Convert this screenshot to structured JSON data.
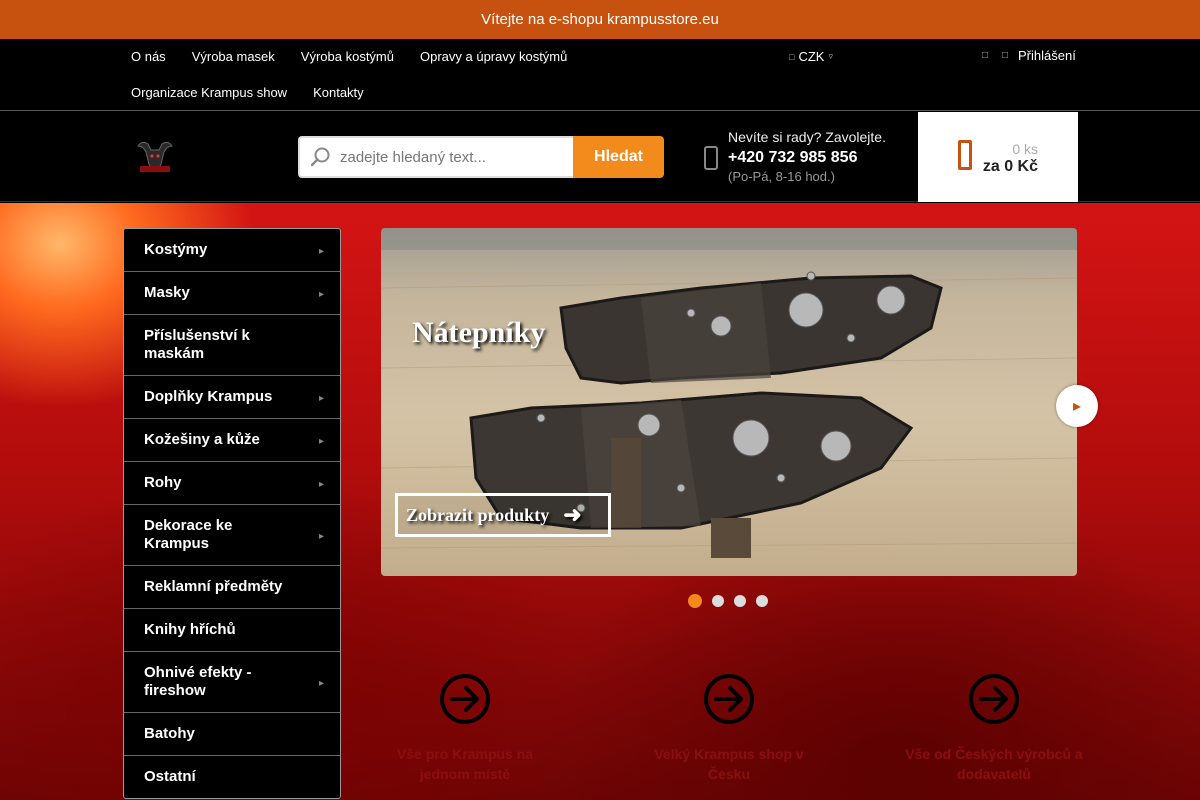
{
  "banner": {
    "text": "Vítejte na e-shopu krampusstore.eu"
  },
  "topnav": {
    "links": [
      "O nás",
      "Výroba masek",
      "Výroba kostýmů",
      "Opravy a úpravy kostýmů",
      "Organizace Krampus show",
      "Kontakty"
    ],
    "currency": "CZK",
    "login": "Přihlášení"
  },
  "header": {
    "search_placeholder": "zadejte hledaný text...",
    "search_button": "Hledat",
    "contact_question": "Nevíte si rady? Zavolejte.",
    "phone": "+420 732 985 856",
    "hours": "(Po-Pá, 8-16 hod.)",
    "cart_count": "0 ks",
    "cart_total": "za 0 Kč"
  },
  "sidebar": {
    "items": [
      {
        "label": "Kostýmy",
        "has_sub": true
      },
      {
        "label": "Masky",
        "has_sub": true
      },
      {
        "label": "Příslušenství k maskám",
        "has_sub": false
      },
      {
        "label": "Doplňky Krampus",
        "has_sub": true
      },
      {
        "label": "Kožešiny a kůže",
        "has_sub": true
      },
      {
        "label": "Rohy",
        "has_sub": true
      },
      {
        "label": "Dekorace ke Krampus",
        "has_sub": true
      },
      {
        "label": "Reklamní předměty",
        "has_sub": false
      },
      {
        "label": "Knihy hříchů",
        "has_sub": false
      },
      {
        "label": "Ohnivé efekty - fireshow",
        "has_sub": true
      },
      {
        "label": "Batohy",
        "has_sub": false
      },
      {
        "label": "Ostatní",
        "has_sub": false
      }
    ]
  },
  "slider": {
    "title": "Nátepníky",
    "button": "Zobrazit produkty",
    "slides_count": 4,
    "active_index": 0
  },
  "benefits": [
    "Vše pro Krampus na jednom místě",
    "Velký Krampus shop v Česku",
    "Vše od Českých výrobců a dodavatelů"
  ],
  "colors": {
    "accent": "#c7520f",
    "button": "#f28a1c",
    "benefit_text": "#8a1010"
  }
}
